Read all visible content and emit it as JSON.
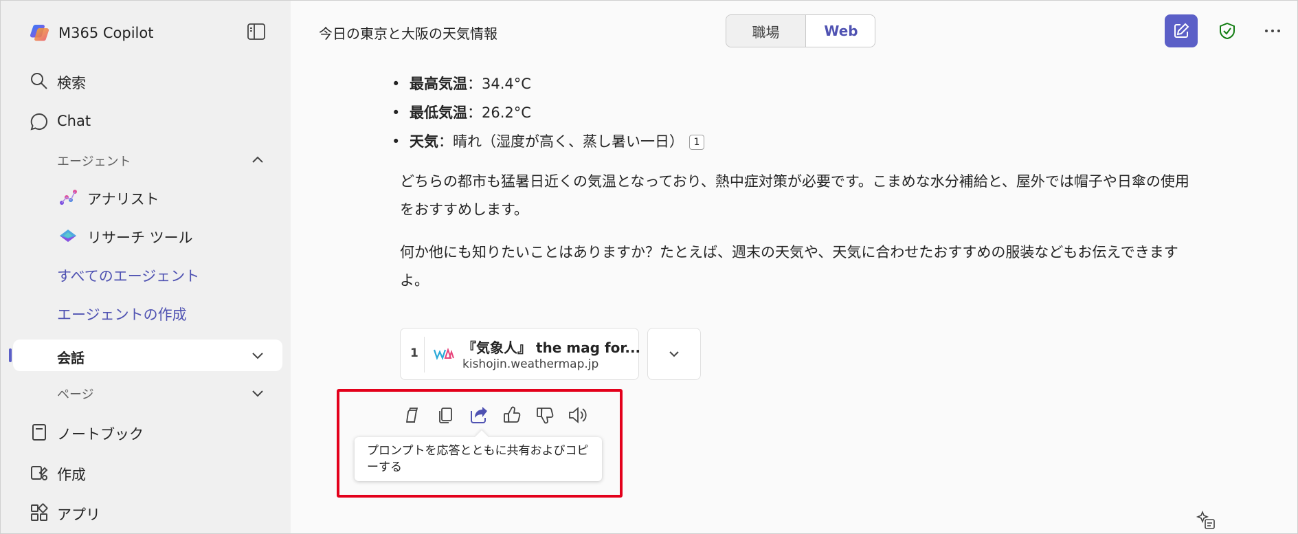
{
  "sidebar": {
    "app_name": "M365 Copilot",
    "search_label": "検索",
    "chat_label": "Chat",
    "agents_header": "エージェント",
    "agents": [
      {
        "label": "アナリスト",
        "icon": "analyst-icon"
      },
      {
        "label": "リサーチ ツール",
        "icon": "researcher-icon"
      }
    ],
    "all_agents_link": "すべてのエージェント",
    "create_agent_link": "エージェントの作成",
    "conversations_label": "会話",
    "pages_label": "ページ",
    "notebook_label": "ノートブック",
    "create_label": "作成",
    "apps_label": "アプリ"
  },
  "header": {
    "chat_title": "今日の東京と大阪の天気情報",
    "toggle": {
      "work": "職場",
      "web": "Web",
      "selected": "web"
    }
  },
  "content": {
    "bullets": [
      {
        "key": "最高気温",
        "sep": "：",
        "value": "34.4°C"
      },
      {
        "key": "最低気温",
        "sep": "：",
        "value": "26.2°C"
      },
      {
        "key": "天気",
        "sep": "：",
        "value": "晴れ（湿度が高く、蒸し暑い一日）",
        "citation": "1"
      }
    ],
    "paragraph1": "どちらの都市も猛暑日近くの気温となっており、熱中症対策が必要です。こまめな水分補給と、屋外では帽子や日傘の使用をおすすめします。",
    "paragraph2": "何か他にも知りたいことはありますか？たとえば、週末の天気や、天気に合わせたおすすめの服装などもお伝えできますよ。",
    "source": {
      "number": "1",
      "title": "『気象人』 the mag for...",
      "domain": "kishojin.weathermap.jp"
    }
  },
  "actions": {
    "tooltip": "プロンプトを応答とともに共有およびコピーする",
    "icons": [
      "pages-icon",
      "copy-icon",
      "share-icon",
      "thumbs-up-icon",
      "thumbs-down-icon",
      "read-aloud-icon"
    ]
  },
  "colors": {
    "accent": "#5b5fc7",
    "link": "#4f52b2",
    "highlight": "#e3001b",
    "shield": "#107c10"
  }
}
